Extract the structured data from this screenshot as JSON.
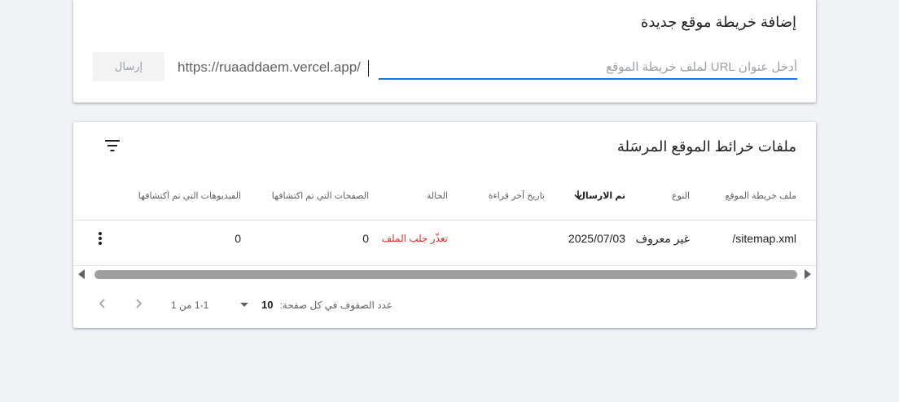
{
  "add_sitemap": {
    "title": "إضافة خريطة موقع جديدة",
    "url_prefix": "https://ruaaddaem.vercel.app/",
    "input_placeholder": "أدخل عنوان URL لملف خريطة الموقع",
    "submit_label": "إرسال"
  },
  "submitted": {
    "title": "ملفات خرائط الموقع المرسَلة",
    "filter_icon": "filter-icon",
    "columns": {
      "sitemap": "ملف خريطة الموقع",
      "type": "النوع",
      "submitted": "تم الارسال",
      "last_read": "تاريخ آخر قراءة",
      "status": "الحالة",
      "pages": "الصفحات التي تم اكتشافها",
      "videos": "الفيديوهات التي تم اكتشافها"
    },
    "rows": [
      {
        "sitemap": "/sitemap.xml",
        "type": "غير معروف",
        "submitted": "2025/07/03",
        "last_read": "",
        "status": "تعذّر جلب الملف",
        "pages": "0",
        "videos": "0"
      }
    ],
    "colors": {
      "accent": "#1a73e8",
      "error": "#d93025"
    }
  },
  "pagination": {
    "rows_per_page_label": "عدد الصفوف في كل صفحة:",
    "rows_per_page_value": "10",
    "range": "1-1 من 1"
  }
}
